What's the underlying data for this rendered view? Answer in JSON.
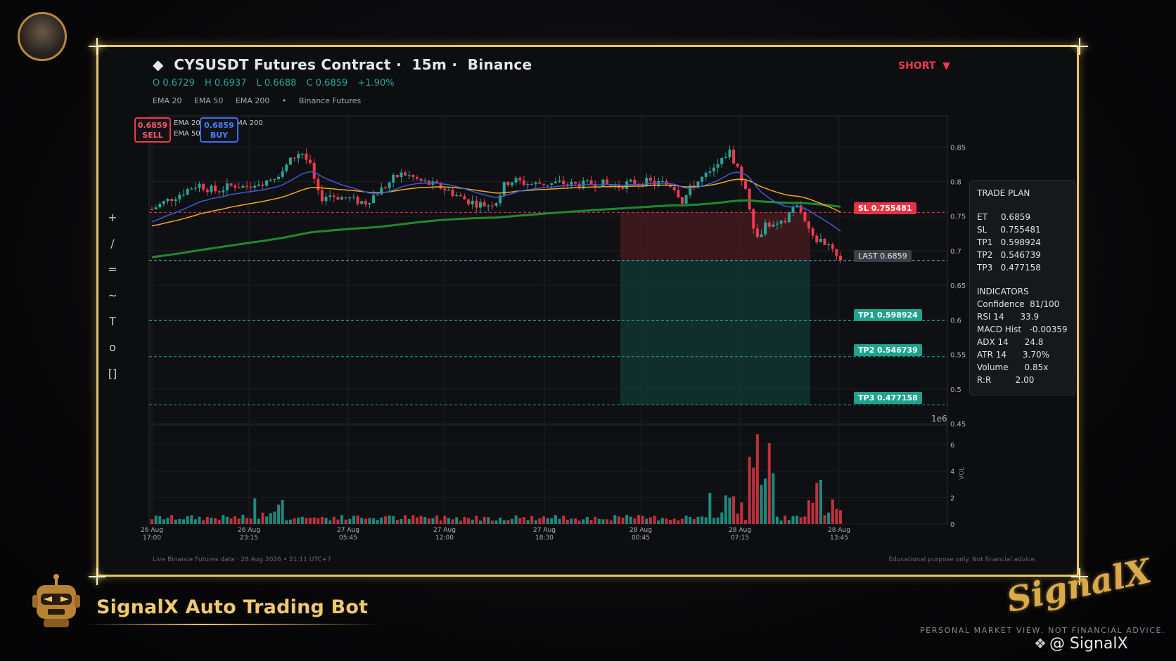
{
  "header": {
    "symbol_title": "CYSUSDT Futures Contract",
    "interval": "15m",
    "exchange": "Binance",
    "side_label": "SHORT",
    "ohlc": {
      "open": "O 0.6729",
      "high": "H 0.6937",
      "low": "L 0.6688",
      "close": "C 0.6859",
      "change": "+1.90%"
    },
    "indicators": [
      "EMA 20",
      "EMA 50",
      "EMA 200",
      "•",
      "Binance Futures"
    ]
  },
  "order_buttons": {
    "sell_price": "0.6859",
    "sell_label": "SELL",
    "buy_price": "0.6859",
    "buy_label": "BUY",
    "legend_ema20": "EMA 20",
    "legend_ema50": "EMA 50",
    "legend_ema200": "MA 200"
  },
  "tools": [
    "+",
    "/",
    "=",
    "~",
    "T",
    "o",
    "[]"
  ],
  "price_tags": {
    "sl": "SL  0.755481",
    "last": "LAST  0.6859",
    "tp1": "TP1  0.598924",
    "tp2": "TP2  0.546739",
    "tp3": "TP3  0.477158"
  },
  "trade_plan": {
    "title": "TRADE PLAN",
    "rows": [
      "ET     0.6859",
      "SL     0.755481",
      "TP1   0.598924",
      "TP2   0.546739",
      "TP3   0.477158"
    ],
    "ind_title": "INDICATORS",
    "ind_rows": [
      "Confidence  81/100",
      "RSI 14      33.9",
      "MACD Hist   -0.00359",
      "ADX 14      24.8",
      "ATR 14      3.70%",
      "Volume      0.85x",
      "R:R         2.00"
    ]
  },
  "chart_data": [
    {
      "type": "candlestick",
      "y_ticks": [
        "0.85",
        "0.8",
        "0.75",
        "0.7",
        "0.65",
        "0.6",
        "0.55",
        "0.5",
        "0.45"
      ],
      "y_range": [
        0.45,
        0.895
      ],
      "y_exponent_label": "1e6",
      "series": [
        {
          "name": "EMA 20",
          "color": "#3b5bdb"
        },
        {
          "name": "EMA 50",
          "color": "#f5a623"
        },
        {
          "name": "EMA 200",
          "color": "#1f8a2e"
        }
      ],
      "levels": {
        "sl": 0.755481,
        "last": 0.6859,
        "tp1": 0.598924,
        "tp2": 0.546739,
        "tp3": 0.477158
      },
      "close_profile": [
        0.76,
        0.768,
        0.775,
        0.782,
        0.79,
        0.796,
        0.79,
        0.786,
        0.792,
        0.795,
        0.792,
        0.798,
        0.8,
        0.806,
        0.815,
        0.832,
        0.845,
        0.822,
        0.775,
        0.781,
        0.778,
        0.776,
        0.772,
        0.77,
        0.782,
        0.792,
        0.805,
        0.812,
        0.806,
        0.8,
        0.796,
        0.792,
        0.786,
        0.778,
        0.772,
        0.768,
        0.766,
        0.772,
        0.798,
        0.802,
        0.798,
        0.796,
        0.798,
        0.797,
        0.798,
        0.796,
        0.795,
        0.797,
        0.799,
        0.795,
        0.793,
        0.797,
        0.799,
        0.8,
        0.798,
        0.797,
        0.795,
        0.772,
        0.792,
        0.804,
        0.812,
        0.826,
        0.845,
        0.818,
        0.778,
        0.716,
        0.742,
        0.732,
        0.742,
        0.768,
        0.752,
        0.718,
        0.714,
        0.708,
        0.686
      ]
    },
    {
      "type": "bar",
      "name": "VOL",
      "y_ticks": [
        "6",
        "4",
        "2",
        "0"
      ],
      "y_range": [
        0,
        7.6
      ],
      "x_ticks": [
        "26 Aug\n17:00",
        "26 Aug\n23:15",
        "27 Aug\n05:45",
        "27 Aug\n12:00",
        "27 Aug\n18:30",
        "28 Aug\n00:45",
        "28 Aug\n07:15",
        "28 Aug\n13:45"
      ]
    }
  ],
  "footer": {
    "left": "Live Binance Futures data  ·  28 Aug 2026 • 21:11 UTC+7",
    "right": "Educational purpose only. Not financial advice."
  },
  "brand": {
    "bot_name": "SignalX Auto Trading Bot",
    "logo_text": "SignalX",
    "disclaimer": "PERSONAL MARKET VIEW, NOT FINANCIAL ADVICE.",
    "handle": "@ SignalX"
  },
  "colors": {
    "frame": "#e8c46a",
    "up": "#26a69a",
    "down": "#ef3a4c",
    "accent": "#f0c96c"
  }
}
